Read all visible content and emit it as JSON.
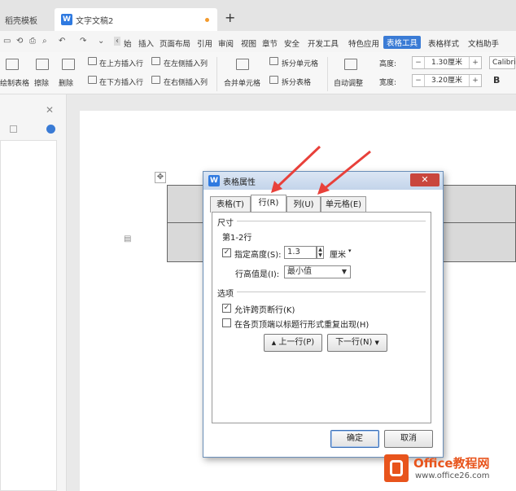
{
  "tabs": {
    "tab1": "稻壳模板",
    "tab2": "文字文稿2",
    "tab2_icon": "W"
  },
  "menu": [
    "始",
    "插入",
    "页面布局",
    "引用",
    "审阅",
    "视图",
    "章节",
    "安全",
    "开发工具",
    "特色应用",
    "表格工具",
    "表格样式",
    "文档助手"
  ],
  "ribbon": {
    "draw_table": "绘制表格",
    "erase": "擦除",
    "delete": "删除",
    "insert_above": "在上方插入行",
    "insert_below": "在下方插入行",
    "insert_left": "在左侧插入列",
    "insert_right": "在右侧插入列",
    "merge": "合并单元格",
    "split_cell": "拆分单元格",
    "split_table": "拆分表格",
    "auto_fit": "自动调整",
    "height_label": "高度:",
    "width_label": "宽度:",
    "height_value": "1.30厘米",
    "width_value": "3.20厘米",
    "font": "Calibri",
    "minus": "−",
    "plus": "+"
  },
  "dialog": {
    "title": "表格属性",
    "icon": "W",
    "tabs": [
      "表格(T)",
      "行(R)",
      "列(U)",
      "单元格(E)"
    ],
    "section_size": "尺寸",
    "row_range": "第1-2行",
    "specify_height": "指定高度(S):",
    "height_value": "1.3",
    "unit": "厘米",
    "row_height_is": "行高值是(I):",
    "row_height_mode": "最小值",
    "section_options": "选项",
    "allow_break": "允许跨页断行(K)",
    "repeat_header": "在各页顶端以标题行形式重复出现(H)",
    "prev_row": "上一行(P)",
    "next_row": "下一行(N)",
    "ok": "确定",
    "cancel": "取消",
    "close": "✕"
  },
  "logo": {
    "name": "Office教程网",
    "url": "www.office26.com",
    "accent": "#e8541c"
  },
  "colors": {
    "accent": "#3a7bd5",
    "arrow": "#e8403a"
  }
}
